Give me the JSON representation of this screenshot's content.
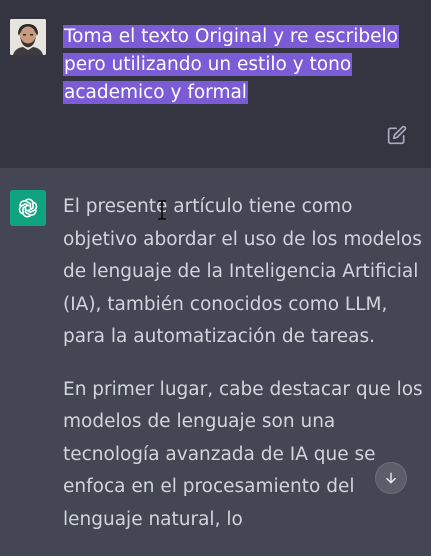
{
  "conversation": {
    "user": {
      "message": "Toma el  texto Original y re escribelo pero utilizando un estilo y tono academico y formal",
      "avatar_icon": "user-avatar",
      "highlight_color": "#7b5bd6"
    },
    "assistant": {
      "logo_icon": "openai-logo-icon",
      "accent_color": "#10a37f",
      "paragraphs": [
        "El presente artículo tiene como objetivo abordar el uso de los modelos de lenguaje de la Inteligencia Artificial (IA), también conocidos como LLM, para la automatización de tareas.",
        "En primer lugar, cabe destacar que los modelos de lenguaje son una tecnología avanzada de IA que se enfoca en el procesamiento del lenguaje natural, lo"
      ]
    }
  },
  "icons": {
    "edit": "edit-icon",
    "scroll_down": "arrow-down-icon",
    "cursor": "text-cursor-icon"
  }
}
